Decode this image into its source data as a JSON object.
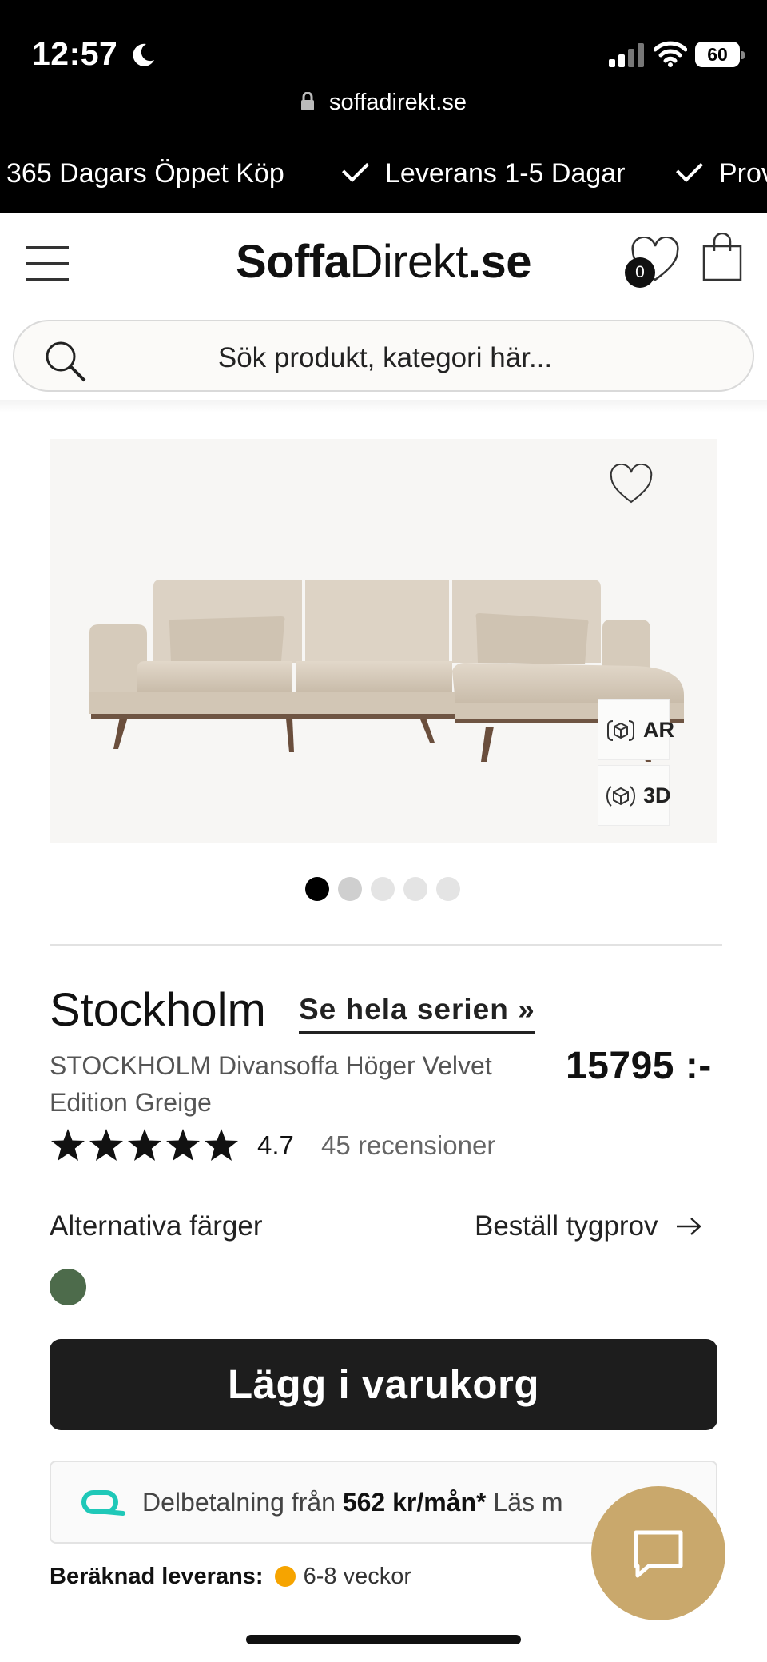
{
  "status_bar": {
    "time": "12:57",
    "battery": "60"
  },
  "browser": {
    "url": "soffadirekt.se"
  },
  "marquee": {
    "items": [
      "365 Dagars Öppet Köp",
      "Leverans 1-5 Dagar",
      "Prov"
    ]
  },
  "header": {
    "logo_bold": "Soffa",
    "logo_regular": "Direkt",
    "logo_tld": ".se",
    "wishlist_count": "0"
  },
  "search": {
    "placeholder": "Sök produkt, kategori här..."
  },
  "gallery": {
    "ar_label": "AR",
    "threed_label": "3D",
    "image_count": 5,
    "active_index": 0
  },
  "product": {
    "series": "Stockholm",
    "series_link": "Se hela serien »",
    "name": "STOCKHOLM Divansoffa Höger Velvet Edition Greige",
    "price": "15795 :-",
    "rating": "4.7",
    "stars": 5,
    "reviews": "45 recensioner",
    "alt_colors_label": "Alternativa färger",
    "fabric_sample_label": "Beställ tygprov",
    "alt_colors": [
      "#4d6b4b"
    ],
    "add_to_cart": "Lägg i varukorg",
    "installment_prefix": "Delbetalning från",
    "installment_amount": "562 kr/mån*",
    "installment_suffix": "Läs m",
    "delivery_label": "Beräknad leverans:",
    "delivery_value": "6-8 veckor"
  },
  "colors": {
    "accent_gold": "#c9a86c",
    "button_dark": "#1d1d1d",
    "delivery_status": "#f6a400",
    "installment_brand": "#1fc8b8"
  }
}
